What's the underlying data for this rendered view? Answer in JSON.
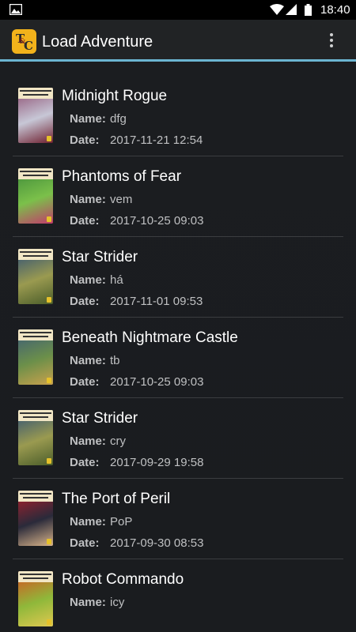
{
  "status_bar": {
    "time": "18:40"
  },
  "toolbar": {
    "logo_text_1": "T",
    "logo_text_2": "C",
    "title": "Load Adventure"
  },
  "labels": {
    "name": "Name:",
    "date": "Date:"
  },
  "items": [
    {
      "title": "Midnight Rogue",
      "name": "dfg",
      "date": "2017-11-21 12:54",
      "cover_colors": [
        "#8b4a6e",
        "#c7c7d6",
        "#6f2030"
      ]
    },
    {
      "title": "Phantoms of Fear",
      "name": "vem",
      "date": "2017-10-25 09:03",
      "cover_colors": [
        "#3f8a3a",
        "#7bc04a",
        "#c23b6b"
      ]
    },
    {
      "title": "Star Strider",
      "name": "há",
      "date": "2017-11-01 09:53",
      "cover_colors": [
        "#2c4e78",
        "#9a9a50",
        "#4b5d2a"
      ]
    },
    {
      "title": "Beneath Nightmare Castle",
      "name": "tb",
      "date": "2017-10-25 09:03",
      "cover_colors": [
        "#3b5a7a",
        "#6b8f4a",
        "#c9a14c"
      ]
    },
    {
      "title": "Star Strider",
      "name": "cry",
      "date": "2017-09-29 19:58",
      "cover_colors": [
        "#2c4e78",
        "#9a9a50",
        "#4b5d2a"
      ]
    },
    {
      "title": "The Port of Peril",
      "name": "PoP",
      "date": "2017-09-30 08:53",
      "cover_colors": [
        "#b11f2a",
        "#2a2a3a",
        "#d9b48a"
      ]
    },
    {
      "title": "Robot Commando",
      "name": "icy",
      "date": "",
      "cover_colors": [
        "#d94e1f",
        "#8fb83a",
        "#e0c850"
      ]
    }
  ]
}
